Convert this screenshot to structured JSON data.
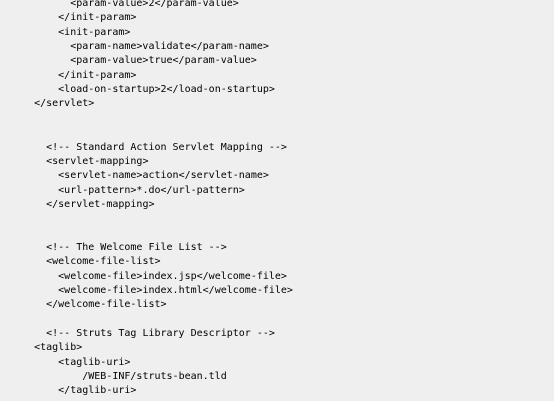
{
  "code_view": {
    "lines": [
      {
        "indent": 10,
        "text": "<param-value>2</param-value>"
      },
      {
        "indent": 8,
        "text": "</init-param>"
      },
      {
        "indent": 8,
        "text": "<init-param>"
      },
      {
        "indent": 10,
        "text": "<param-name>validate</param-name>"
      },
      {
        "indent": 10,
        "text": "<param-value>true</param-value>"
      },
      {
        "indent": 8,
        "text": "</init-param>"
      },
      {
        "indent": 8,
        "text": "<load-on-startup>2</load-on-startup>"
      },
      {
        "indent": 4,
        "text": "</servlet>"
      },
      {
        "indent": 0,
        "text": ""
      },
      {
        "indent": 0,
        "text": ""
      },
      {
        "indent": 6,
        "text": "<!-- Standard Action Servlet Mapping -->"
      },
      {
        "indent": 6,
        "text": "<servlet-mapping>"
      },
      {
        "indent": 8,
        "text": "<servlet-name>action</servlet-name>"
      },
      {
        "indent": 8,
        "text": "<url-pattern>*.do</url-pattern>"
      },
      {
        "indent": 6,
        "text": "</servlet-mapping>"
      },
      {
        "indent": 0,
        "text": ""
      },
      {
        "indent": 0,
        "text": ""
      },
      {
        "indent": 6,
        "text": "<!-- The Welcome File List -->"
      },
      {
        "indent": 6,
        "text": "<welcome-file-list>"
      },
      {
        "indent": 8,
        "text": "<welcome-file>index.jsp</welcome-file>"
      },
      {
        "indent": 8,
        "text": "<welcome-file>index.html</welcome-file>"
      },
      {
        "indent": 6,
        "text": "</welcome-file-list>"
      },
      {
        "indent": 0,
        "text": ""
      },
      {
        "indent": 6,
        "text": "<!-- Struts Tag Library Descriptor -->"
      },
      {
        "indent": 4,
        "text": "<taglib>"
      },
      {
        "indent": 8,
        "text": "<taglib-uri>"
      },
      {
        "indent": 12,
        "text": "/WEB-INF/struts-bean.tld"
      },
      {
        "indent": 8,
        "text": "</taglib-uri>"
      }
    ]
  }
}
